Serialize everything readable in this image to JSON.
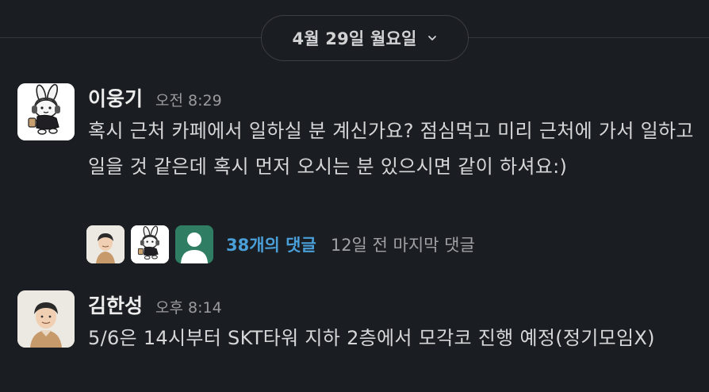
{
  "date_divider": {
    "label": "4월 29일 월요일",
    "icon": "chevron-down-icon"
  },
  "messages": [
    {
      "sender": "이웅기",
      "time": "오전 8:29",
      "text": "혹시 근처 카페에서 일하실 분 계신가요? 점심먹고 미리 근처에 가서 일하고 일을 것 같은데 혹시 먼저 오시는 분 있으시면 같이 하셔요:)",
      "avatar": "rabbit-character-avatar",
      "thread": {
        "participants": [
          "person-avatar",
          "rabbit-character-avatar",
          "default-user-avatar"
        ],
        "reply_count": "38개의 댓글",
        "last_reply": "12일 전 마지막 댓글"
      }
    },
    {
      "sender": "김한성",
      "time": "오후 8:14",
      "text": "5/6은 14시부터 SKT타워 지하 2층에서 모각코 진행 예정(정기모임X)",
      "avatar": "person-avatar"
    }
  ],
  "colors": {
    "background": "#1a1d21",
    "link": "#4a9fd8",
    "default_avatar": "#2f7d63"
  }
}
